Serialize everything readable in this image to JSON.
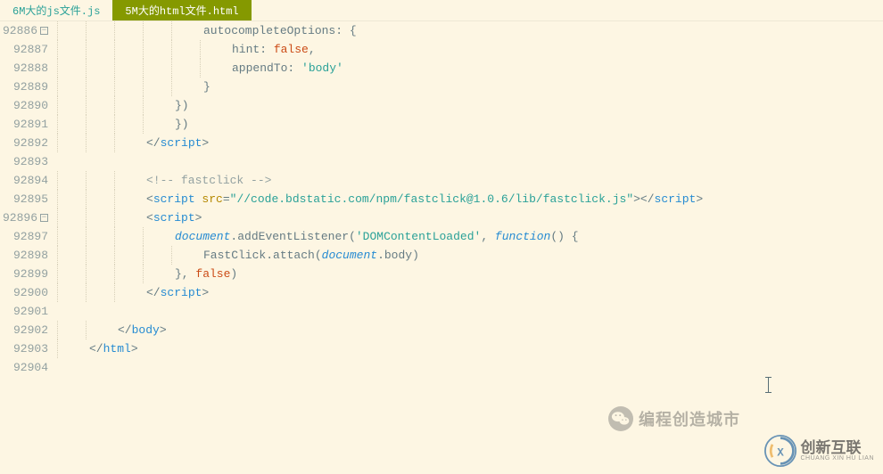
{
  "tabs": [
    {
      "label": "6M大的js文件.js",
      "active": false
    },
    {
      "label": "5M大的html文件.html",
      "active": true
    }
  ],
  "lines": [
    {
      "num": "92886",
      "fold": true,
      "indent": 5,
      "html": "<span class='tok-prop'>autocompleteOptions</span><span class='tok-punct'>: {</span>"
    },
    {
      "num": "92887",
      "fold": false,
      "indent": 6,
      "html": "<span class='tok-prop'>hint</span><span class='tok-punct'>: </span><span class='tok-bool'>false</span><span class='tok-punct'>,</span>"
    },
    {
      "num": "92888",
      "fold": false,
      "indent": 6,
      "html": "<span class='tok-prop'>appendTo</span><span class='tok-punct'>: </span><span class='tok-str'>'body'</span>"
    },
    {
      "num": "92889",
      "fold": false,
      "indent": 5,
      "html": "<span class='tok-punct'>}</span>"
    },
    {
      "num": "92890",
      "fold": false,
      "indent": 4,
      "html": "<span class='tok-punct'>})</span>"
    },
    {
      "num": "92891",
      "fold": false,
      "indent": 4,
      "html": "<span class='tok-punct'>})</span>"
    },
    {
      "num": "92892",
      "fold": false,
      "indent": 3,
      "html": "<span class='tok-punct'>&lt;/</span><span class='tok-tag'>script</span><span class='tok-punct'>&gt;</span>"
    },
    {
      "num": "92893",
      "fold": false,
      "indent": 0,
      "html": ""
    },
    {
      "num": "92894",
      "fold": false,
      "indent": 3,
      "html": "<span class='tok-comment'>&lt;!-- fastclick --&gt;</span>"
    },
    {
      "num": "92895",
      "fold": false,
      "indent": 3,
      "html": "<span class='tok-punct'>&lt;</span><span class='tok-tag'>script </span><span class='tok-attr'>src</span><span class='tok-punct'>=</span><span class='tok-str'>\"//code.bdstatic.com/npm/fastclick@1.0.6/lib/fastclick.js\"</span><span class='tok-punct'>&gt;&lt;/</span><span class='tok-tag'>script</span><span class='tok-punct'>&gt;</span>"
    },
    {
      "num": "92896",
      "fold": true,
      "indent": 3,
      "html": "<span class='tok-punct'>&lt;</span><span class='tok-tag'>script</span><span class='tok-punct'>&gt;</span>"
    },
    {
      "num": "92897",
      "fold": false,
      "indent": 4,
      "html": "<span class='tok-var'>document</span><span class='tok-punct'>.</span><span class='tok-func'>addEventListener</span><span class='tok-punct'>(</span><span class='tok-str'>'DOMContentLoaded'</span><span class='tok-punct'>, </span><span class='tok-var'>function</span><span class='tok-punct'>() {</span>"
    },
    {
      "num": "92898",
      "fold": false,
      "indent": 5,
      "html": "<span class='tok-func'>FastClick.attach</span><span class='tok-punct'>(</span><span class='tok-var'>document</span><span class='tok-punct'>.body)</span>"
    },
    {
      "num": "92899",
      "fold": false,
      "indent": 4,
      "html": "<span class='tok-punct'>}, </span><span class='tok-bool'>false</span><span class='tok-punct'>)</span>"
    },
    {
      "num": "92900",
      "fold": false,
      "indent": 3,
      "html": "<span class='tok-punct'>&lt;/</span><span class='tok-tag'>script</span><span class='tok-punct'>&gt;</span>"
    },
    {
      "num": "92901",
      "fold": false,
      "indent": 0,
      "html": ""
    },
    {
      "num": "92902",
      "fold": false,
      "indent": 2,
      "html": "<span class='tok-punct'>&lt;/</span><span class='tok-tag'>body</span><span class='tok-punct'>&gt;</span>"
    },
    {
      "num": "92903",
      "fold": false,
      "indent": 1,
      "html": "<span class='tok-punct'>&lt;/</span><span class='tok-tag'>html</span><span class='tok-punct'>&gt;</span>"
    },
    {
      "num": "92904",
      "fold": false,
      "indent": 0,
      "html": ""
    }
  ],
  "watermarks": {
    "chat_text": "编程创造城市",
    "cx_main": "创新互联",
    "cx_sub": "CHUANG XIN HU LIAN"
  }
}
